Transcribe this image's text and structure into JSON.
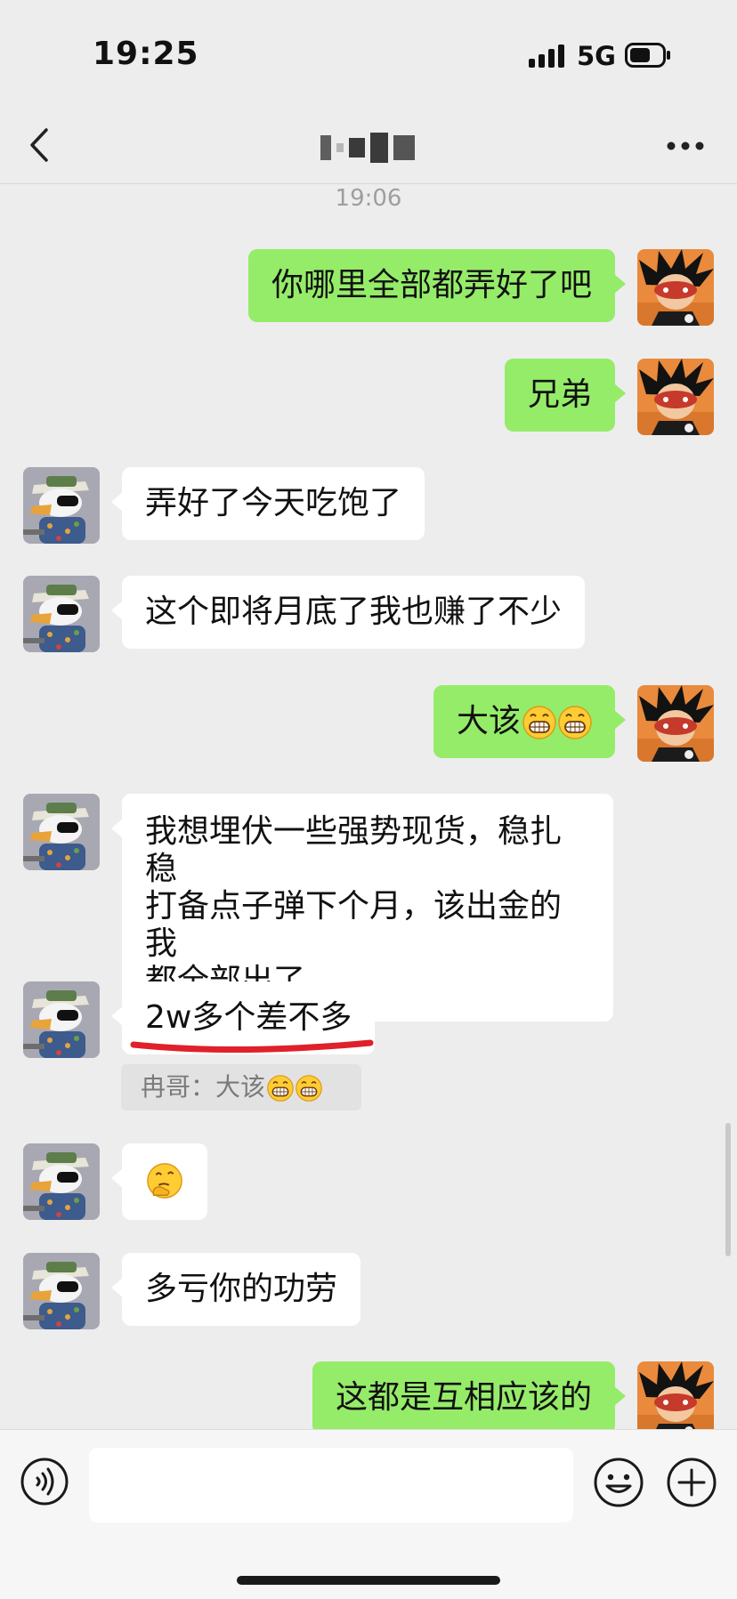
{
  "status_bar": {
    "time": "19:25",
    "network": "5G"
  },
  "header": {
    "back_icon": "chevron-left-icon",
    "title": "",
    "more_icon": "more-icon"
  },
  "chat": {
    "timestamp": "19:06",
    "messages": [
      {
        "sender": "me",
        "text": "你哪里全部都弄好了吧"
      },
      {
        "sender": "me",
        "text": "兄弟"
      },
      {
        "sender": "them",
        "text": "弄好了今天吃饱了"
      },
      {
        "sender": "them",
        "text": "这个即将月底了我也赚了不少"
      },
      {
        "sender": "me",
        "text": "大该",
        "emojis": [
          "grin-emoji",
          "grin-emoji"
        ]
      },
      {
        "sender": "them",
        "lines": [
          "我想埋伏一些强势现货，稳扎稳",
          "打备点子弹下个月，该出金的我",
          "都全部出了"
        ]
      },
      {
        "sender": "them",
        "text": "2w多个差不多",
        "quote": "冉哥：大该"
      },
      {
        "sender": "them",
        "emojis": [
          "thinking-emoji"
        ]
      },
      {
        "sender": "them",
        "text": "多亏你的功劳"
      },
      {
        "sender": "me",
        "text": "这都是互相应该的"
      }
    ]
  },
  "input": {
    "placeholder": ""
  },
  "colors": {
    "me_bubble": "#95ec69",
    "them_bubble": "#ffffff",
    "background": "#ededed",
    "underline": "#e0202a"
  }
}
